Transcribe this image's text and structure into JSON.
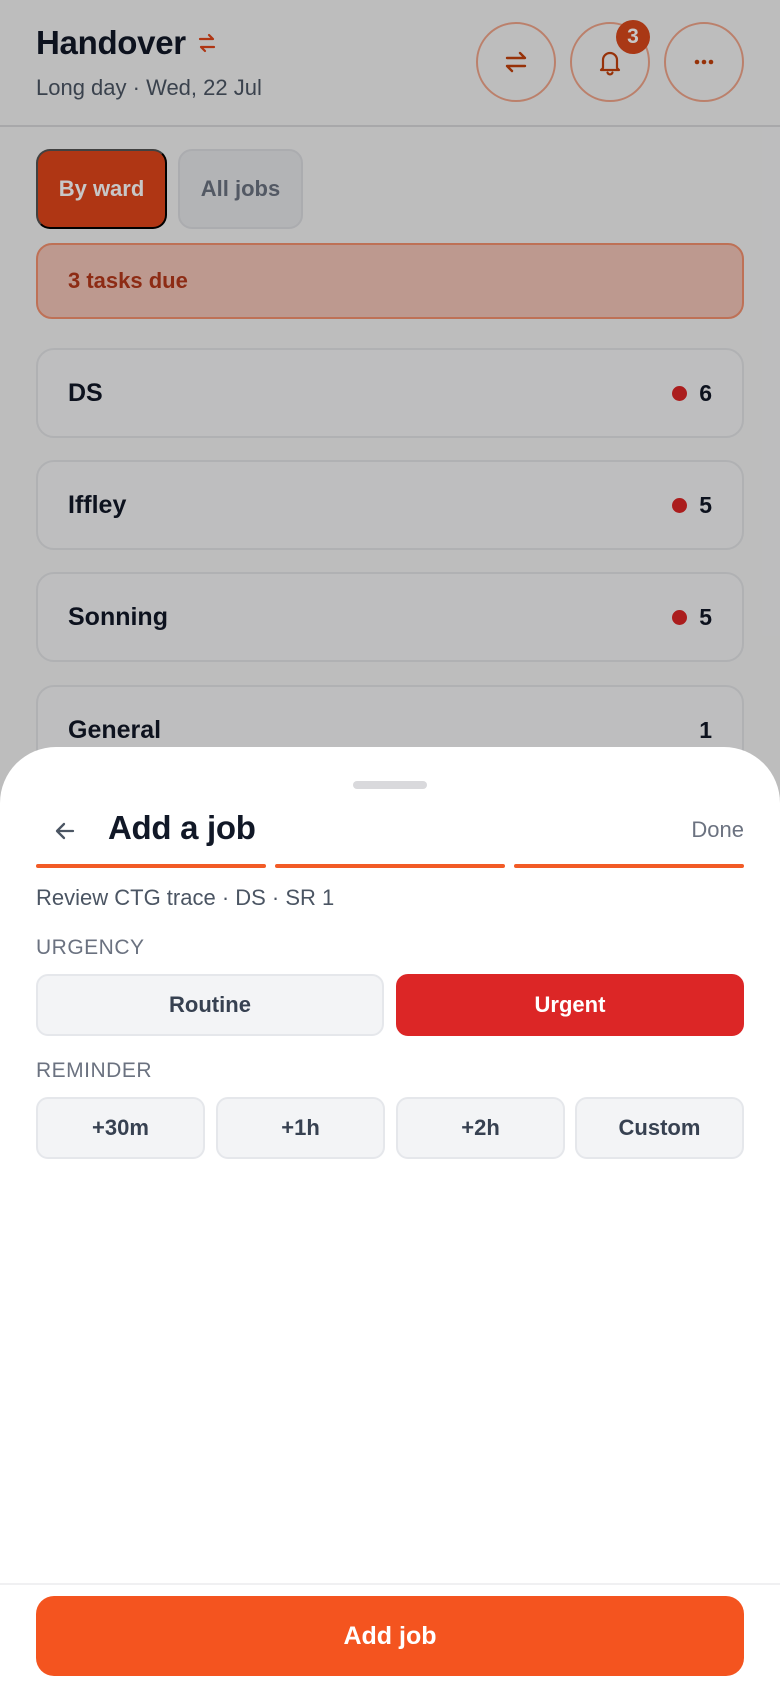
{
  "header": {
    "title": "Handover",
    "subtitle": "Long day · Wed, 22 Jul",
    "notifications_count": "3",
    "swap_icon": "swap-icon",
    "bell_icon": "bell-icon",
    "more_icon": "more-icon"
  },
  "view_toggle": {
    "by_ward": "By ward",
    "all_jobs": "All jobs",
    "selected": "By ward"
  },
  "due_banner": "3 tasks due",
  "wards": [
    {
      "name": "DS",
      "count": "6",
      "has_due": true
    },
    {
      "name": "Iffley",
      "count": "5",
      "has_due": true
    },
    {
      "name": "Sonning",
      "count": "5",
      "has_due": true
    },
    {
      "name": "General",
      "count": "1",
      "has_due": false
    }
  ],
  "sheet": {
    "title": "Add a job",
    "done_label": "Done",
    "context": "Review CTG trace · DS · SR 1",
    "steps_total": 3,
    "steps_completed": 3,
    "urgency": {
      "label": "URGENCY",
      "options": [
        "Routine",
        "Urgent"
      ],
      "selected": "Urgent"
    },
    "reminder": {
      "label": "REMINDER",
      "options": [
        "+30m",
        "+1h",
        "+2h",
        "Custom"
      ],
      "selected": null
    },
    "submit_label": "Add job"
  },
  "colors": {
    "accent": "#f4541f",
    "urgent": "#dc2626",
    "badge": "#d9481c"
  }
}
